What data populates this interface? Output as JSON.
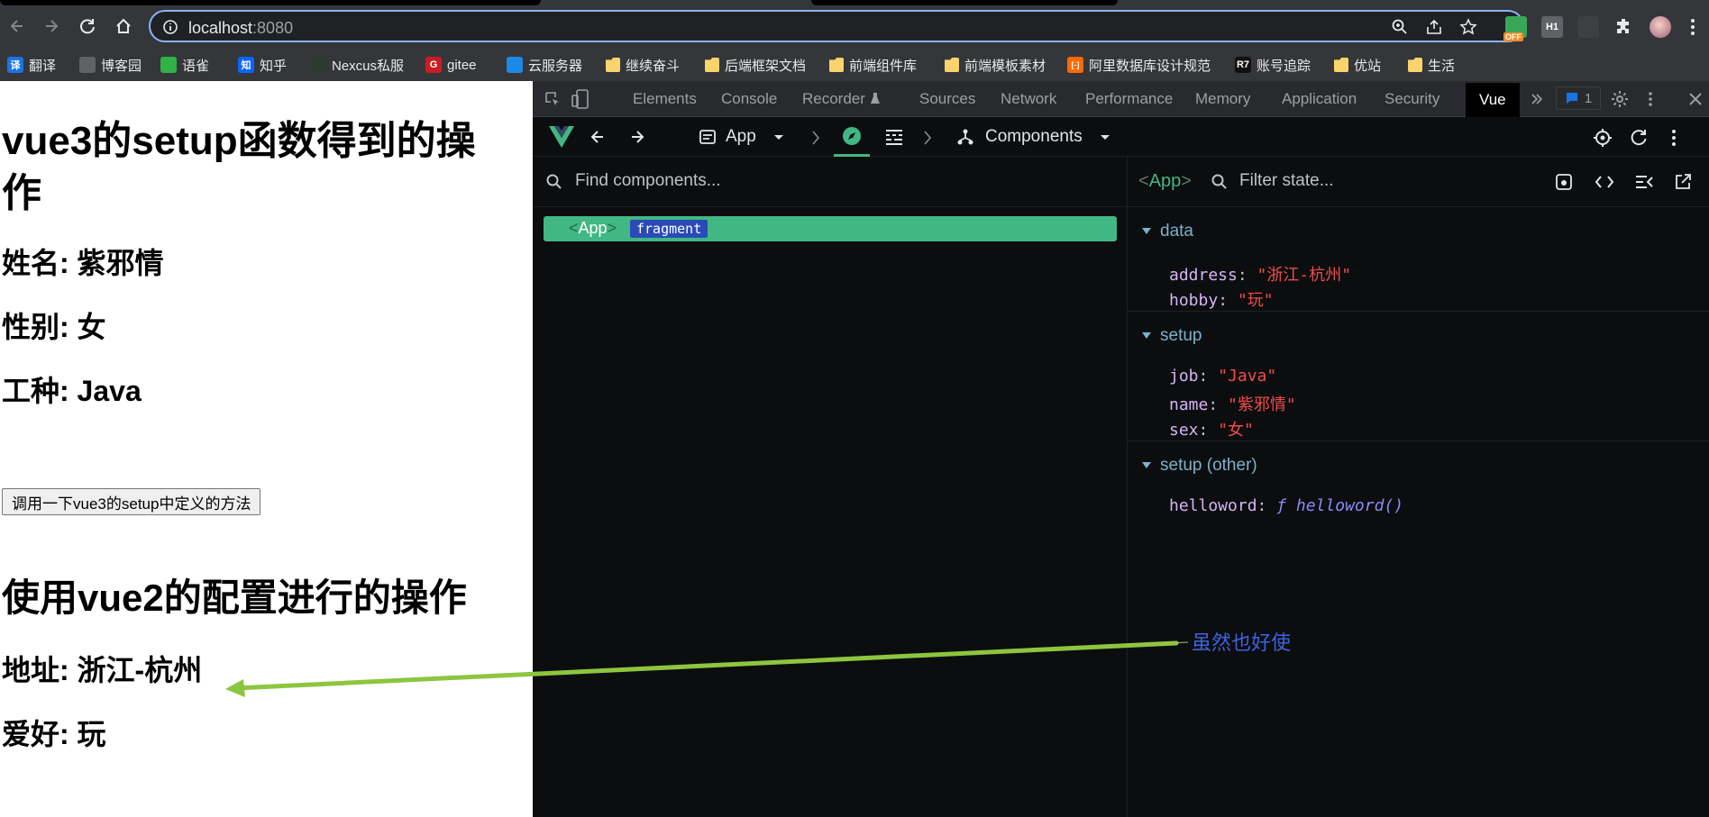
{
  "browser": {
    "url_host": "localhost",
    "url_port": ":8080",
    "extension_off_badge": "OFF",
    "extension_h1": "H1"
  },
  "bookmarks": [
    {
      "label": "翻译",
      "icon": "translate-icon",
      "color": "#1a73e8",
      "glyph": "译"
    },
    {
      "label": "博客园",
      "icon": "blog-icon",
      "color": "#5f6368",
      "glyph": ""
    },
    {
      "label": "语雀",
      "icon": "yuque-icon",
      "color": "#2fb344",
      "glyph": ""
    },
    {
      "label": "知乎",
      "icon": "zhihu-icon",
      "color": "#0a66ff",
      "glyph": "知"
    },
    {
      "label": "Nexcus私服",
      "icon": "nexus-icon",
      "color": "#2d3b2f",
      "glyph": ""
    },
    {
      "label": "gitee",
      "icon": "gitee-icon",
      "color": "#c71d23",
      "glyph": "G"
    },
    {
      "label": "云服务器",
      "icon": "cloud-icon",
      "color": "#1e88e5",
      "glyph": ""
    },
    {
      "label": "继续奋斗",
      "icon": "folder-icon",
      "color": "#f9d36b",
      "glyph": ""
    },
    {
      "label": "后端框架文档",
      "icon": "folder-icon",
      "color": "#f9d36b",
      "glyph": ""
    },
    {
      "label": "前端组件库",
      "icon": "folder-icon",
      "color": "#f9d36b",
      "glyph": ""
    },
    {
      "label": "前端模板素材",
      "icon": "folder-icon",
      "color": "#f9d36b",
      "glyph": ""
    },
    {
      "label": "阿里数据库设计规范",
      "icon": "aliyun-icon",
      "color": "#ff6a00",
      "glyph": "[-]"
    },
    {
      "label": "账号追踪",
      "icon": "r7-icon",
      "color": "#111111",
      "glyph": "R7"
    },
    {
      "label": "优站",
      "icon": "folder-icon",
      "color": "#f9d36b",
      "glyph": ""
    },
    {
      "label": "生活",
      "icon": "folder-icon",
      "color": "#f9d36b",
      "glyph": ""
    }
  ],
  "page": {
    "title_setup": "vue3的setup函数得到的操作",
    "name_line": "姓名: 紫邪情",
    "sex_line": "性别: 女",
    "job_line": "工种: Java",
    "button_label": "调用一下vue3的setup中定义的方法",
    "title_vue2": "使用vue2的配置进行的操作",
    "address_line": "地址: 浙江-杭州",
    "hobby_line": "爱好: 玩"
  },
  "devtools": {
    "tabs": [
      "Elements",
      "Console",
      "Recorder",
      "Sources",
      "Network",
      "Performance",
      "Memory",
      "Application",
      "Security",
      "Vue"
    ],
    "active_tab": "Vue",
    "issues_count": "1",
    "vue": {
      "app_label": "App",
      "view_label": "Components",
      "find_placeholder": "Find components...",
      "selected_component": "App",
      "filter_placeholder": "Filter state...",
      "tree": [
        {
          "name": "App",
          "badge": "fragment"
        }
      ],
      "sections": [
        {
          "title": "data",
          "props": [
            {
              "key": "address",
              "value": "\"浙江-杭州\""
            },
            {
              "key": "hobby",
              "value": "\"玩\""
            }
          ]
        },
        {
          "title": "setup",
          "props": [
            {
              "key": "job",
              "value": "\"Java\""
            },
            {
              "key": "name",
              "value": "\"紫邪情\""
            },
            {
              "key": "sex",
              "value": "\"女\""
            }
          ]
        },
        {
          "title": "setup (other)",
          "props": [
            {
              "key": "helloword",
              "value": "ƒ helloword()"
            }
          ]
        }
      ]
    }
  },
  "annotation": {
    "note": "虽然也好使",
    "color": "#3b64e0",
    "arrow_color": "#8cc63f"
  }
}
